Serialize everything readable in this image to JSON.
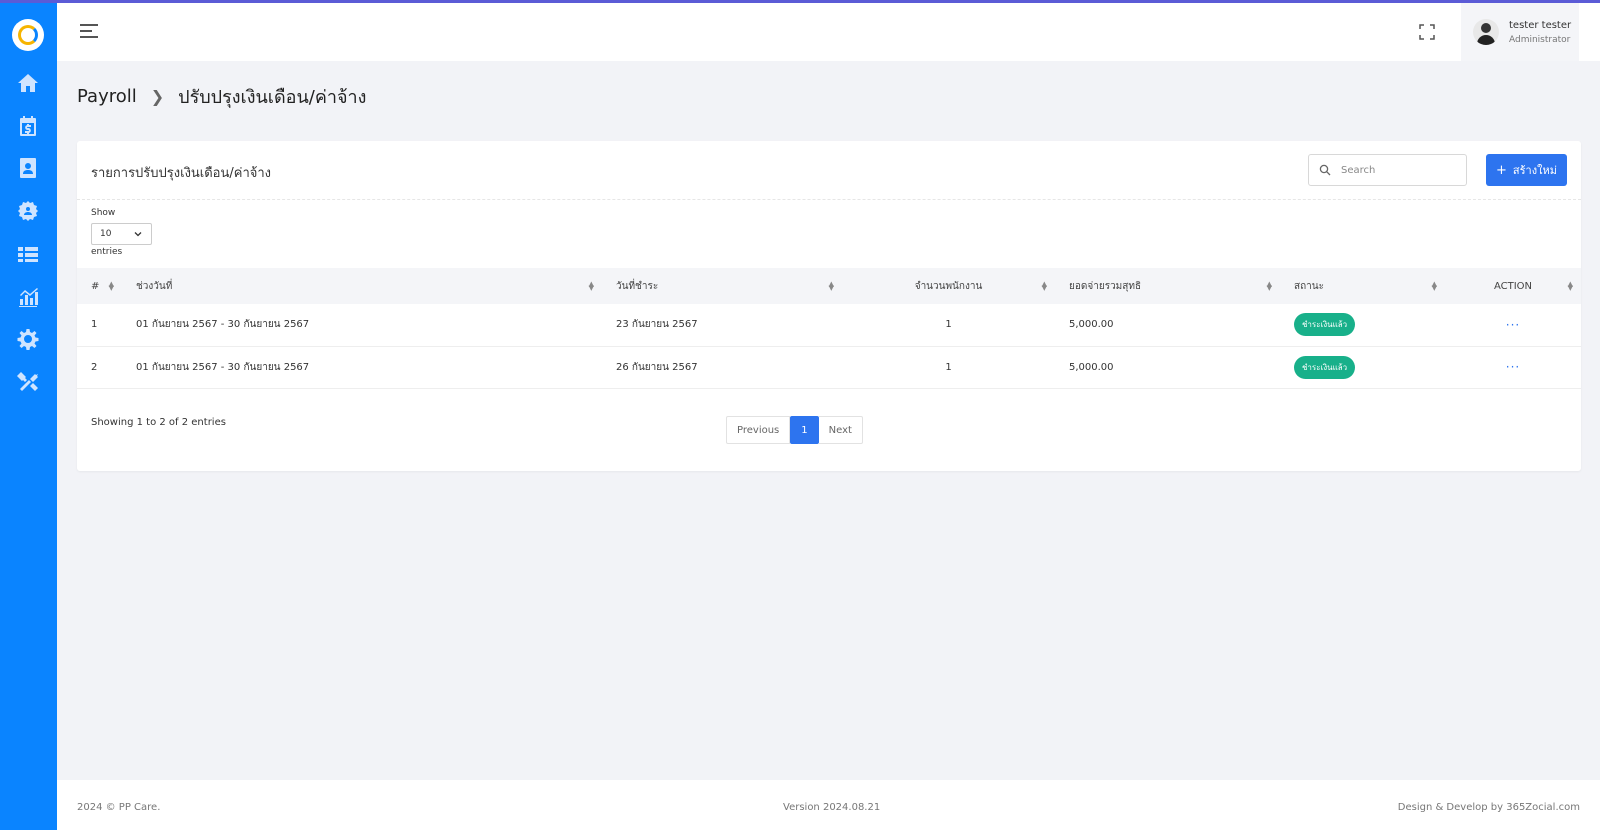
{
  "header": {
    "user_name": "tester tester",
    "user_role": "Administrator"
  },
  "breadcrumb": {
    "root": "Payroll",
    "current": "ปรับปรุงเงินเดือน/ค่าจ้าง"
  },
  "card": {
    "title": "รายการปรับปรุงเงินเดือน/ค่าจ้าง",
    "search_placeholder": "Search",
    "create_label": "สร้างใหม่"
  },
  "length": {
    "show_label": "Show",
    "selected": "10",
    "entries_label": "entries"
  },
  "table": {
    "columns": [
      "#",
      "ช่วงวันที่",
      "วันที่ชำระ",
      "จำนวนพนักงาน",
      "ยอดจ่ายรวมสุทธิ",
      "สถานะ",
      "ACTION"
    ],
    "rows": [
      {
        "no": "1",
        "range": "01 กันยายน 2567 - 30 กันยายน 2567",
        "paid_date": "23 กันยายน 2567",
        "employees": "1",
        "total": "5,000.00",
        "status": "ชำระเงินแล้ว",
        "action": "···"
      },
      {
        "no": "2",
        "range": "01 กันยายน 2567 - 30 กันยายน 2567",
        "paid_date": "26 กันยายน 2567",
        "employees": "1",
        "total": "5,000.00",
        "status": "ชำระเงินแล้ว",
        "action": "···"
      }
    ]
  },
  "pagination": {
    "info": "Showing 1 to 2 of 2 entries",
    "prev": "Previous",
    "current": "1",
    "next": "Next"
  },
  "footer": {
    "copyright": "2024 © PP Care.",
    "version": "Version 2024.08.21",
    "credit": "Design & Develop by 365Zocial.com"
  },
  "colors": {
    "sidebar": "#0a84ff",
    "primary": "#2d74ef",
    "success": "#18b08a"
  }
}
